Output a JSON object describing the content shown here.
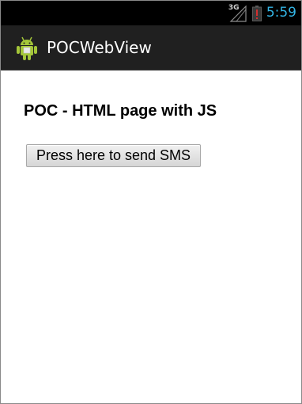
{
  "status_bar": {
    "network_type": "3G",
    "time": "5:59",
    "icons": [
      "signal-icon",
      "battery-alert-icon"
    ],
    "colors": {
      "time": "#33b5e5",
      "battery_alert": "#d32f2f"
    }
  },
  "action_bar": {
    "app_icon": "android-icon",
    "title": "POCWebView"
  },
  "page": {
    "heading": "POC - HTML page with JS",
    "send_sms_button": "Press here to send SMS"
  }
}
